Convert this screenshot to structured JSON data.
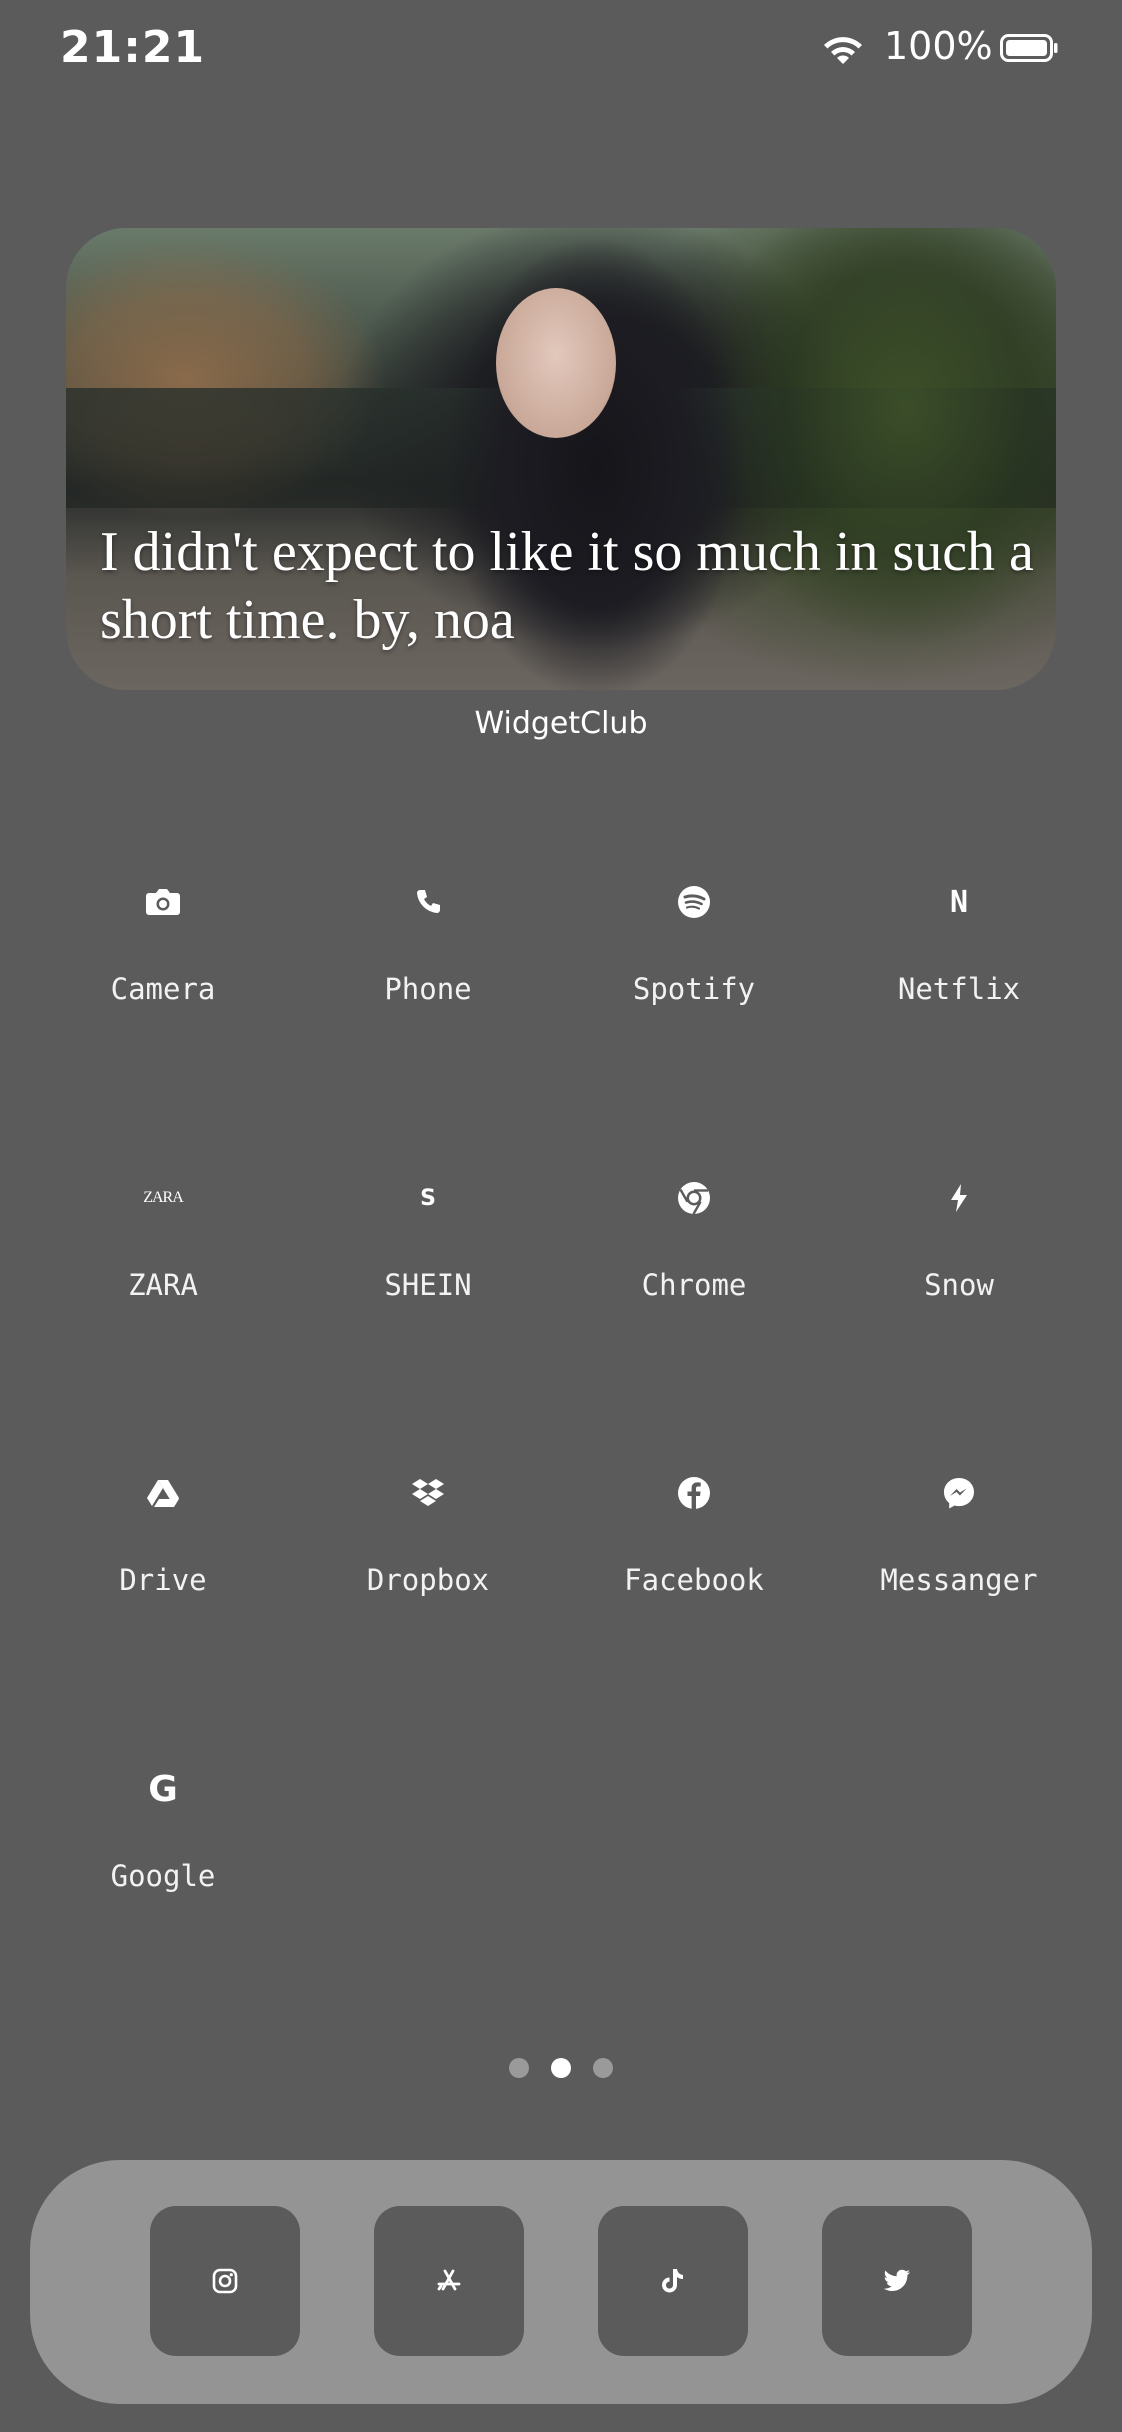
{
  "status_bar": {
    "time": "21:21",
    "battery_percent": "100%"
  },
  "widget": {
    "quote": "I didn't expect to like it so much in such a short time.  by,  noa",
    "label": "WidgetClub"
  },
  "apps": [
    {
      "label": "Camera",
      "icon": "camera-icon"
    },
    {
      "label": "Phone",
      "icon": "phone-icon"
    },
    {
      "label": "Spotify",
      "icon": "spotify-icon"
    },
    {
      "label": "Netflix",
      "icon": "netflix-icon",
      "glyph": "N"
    },
    {
      "label": "ZARA",
      "icon": "zara-icon",
      "glyph": "ZARA"
    },
    {
      "label": "SHEIN",
      "icon": "shein-icon",
      "glyph": "S"
    },
    {
      "label": "Chrome",
      "icon": "chrome-icon"
    },
    {
      "label": "Snow",
      "icon": "bolt-icon"
    },
    {
      "label": "Drive",
      "icon": "drive-icon"
    },
    {
      "label": "Dropbox",
      "icon": "dropbox-icon"
    },
    {
      "label": "Facebook",
      "icon": "facebook-icon"
    },
    {
      "label": "Messanger",
      "icon": "messenger-icon"
    },
    {
      "label": "Google",
      "icon": "google-icon",
      "glyph": "G"
    }
  ],
  "page_indicator": {
    "pages": 3,
    "current": 2
  },
  "dock": [
    {
      "icon": "instagram-icon"
    },
    {
      "icon": "app-store-icon"
    },
    {
      "icon": "tiktok-icon"
    },
    {
      "icon": "twitter-icon"
    }
  ],
  "colors": {
    "background": "#5b5b5b",
    "dock": "#949494",
    "dock_icon_bg": "#5b5b5b",
    "text": "#ffffff"
  }
}
